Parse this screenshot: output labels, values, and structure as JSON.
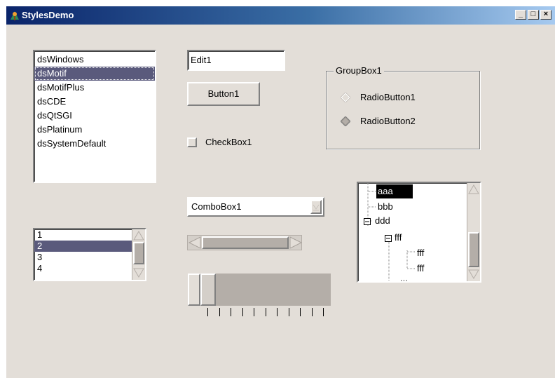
{
  "window": {
    "title": "StylesDemo",
    "controls": {
      "minimize": "_",
      "maximize": "□",
      "close": "×"
    }
  },
  "style_list": {
    "items": [
      "dsWindows",
      "dsMotif",
      "dsMotifPlus",
      "dsCDE",
      "dsQtSGI",
      "dsPlatinum",
      "dsSystemDefault"
    ],
    "selected_index": 1
  },
  "edit": {
    "value": "Edit1"
  },
  "button": {
    "label": "Button1"
  },
  "checkbox": {
    "label": "CheckBox1",
    "checked": false
  },
  "groupbox": {
    "title": "GroupBox1",
    "radios": [
      {
        "label": "RadioButton1",
        "checked": false
      },
      {
        "label": "RadioButton2",
        "checked": true
      }
    ]
  },
  "combobox": {
    "value": "ComboBox1"
  },
  "number_list": {
    "items": [
      "1",
      "2",
      "3",
      "4"
    ],
    "selected_index": 1
  },
  "trackbar": {
    "tick_count": 11,
    "position": 0
  },
  "tree": {
    "nodes": [
      {
        "label": "aaa",
        "level": 0,
        "selected": true
      },
      {
        "label": "bbb",
        "level": 0
      },
      {
        "label": "ddd",
        "level": 0,
        "expanded": true
      },
      {
        "label": "fff",
        "level": 1,
        "expanded": true
      },
      {
        "label": "fff",
        "level": 2
      },
      {
        "label": "fff",
        "level": 2
      }
    ]
  },
  "icons": {
    "app": "app-icon",
    "scroll_up": "up-arrow-icon",
    "scroll_down": "down-arrow-icon",
    "scroll_left": "left-arrow-icon",
    "scroll_right": "right-arrow-icon",
    "combo_drop": "chevron-down-icon",
    "tree_collapse": "minus-box-icon"
  },
  "colors": {
    "face": "#e3ded8",
    "selection": "#5a5a7c",
    "title_start": "#0a246a",
    "title_end": "#a6caf0"
  }
}
